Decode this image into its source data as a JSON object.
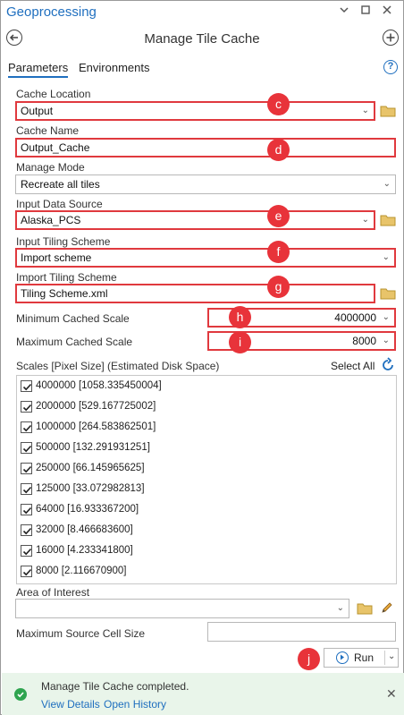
{
  "window": {
    "title": "Geoprocessing",
    "controls": [
      "chevron-down-icon",
      "pin-icon",
      "close-icon"
    ]
  },
  "tool": {
    "title": "Manage Tile Cache"
  },
  "tabs": [
    {
      "label": "Parameters",
      "active": true
    },
    {
      "label": "Environments",
      "active": false
    }
  ],
  "params": {
    "cache_location": {
      "label": "Cache Location",
      "value": "Output",
      "callout": "c"
    },
    "cache_name": {
      "label": "Cache Name",
      "value": "Output_Cache",
      "callout": "d"
    },
    "manage_mode": {
      "label": "Manage Mode",
      "value": "Recreate all tiles"
    },
    "input_data_source": {
      "label": "Input Data Source",
      "value": "Alaska_PCS",
      "callout": "e"
    },
    "input_tiling_scheme": {
      "label": "Input Tiling Scheme",
      "value": "Import scheme",
      "callout": "f"
    },
    "import_tiling_scheme": {
      "label": "Import Tiling Scheme",
      "value": "Tiling Scheme.xml",
      "callout": "g"
    },
    "min_cached_scale": {
      "label": "Minimum Cached Scale",
      "value": "4000000",
      "callout": "h"
    },
    "max_cached_scale": {
      "label": "Maximum Cached Scale",
      "value": "8000",
      "callout": "i"
    }
  },
  "scales": {
    "header": "Scales [Pixel Size] (Estimated Disk Space)",
    "select_all": "Select All",
    "items": [
      {
        "label": "4000000 [1058.335450004]",
        "checked": true
      },
      {
        "label": "2000000 [529.167725002]",
        "checked": true
      },
      {
        "label": "1000000 [264.583862501]",
        "checked": true
      },
      {
        "label": "500000 [132.291931251]",
        "checked": true
      },
      {
        "label": "250000 [66.145965625]",
        "checked": true
      },
      {
        "label": "125000 [33.072982813]",
        "checked": true
      },
      {
        "label": "64000 [16.933367200]",
        "checked": true
      },
      {
        "label": "32000 [8.466683600]",
        "checked": true
      },
      {
        "label": "16000 [4.233341800]",
        "checked": true
      },
      {
        "label": "8000 [2.116670900]",
        "checked": true
      }
    ]
  },
  "area_of_interest": {
    "label": "Area of Interest",
    "value": ""
  },
  "max_source_cell_size": {
    "label": "Maximum Source Cell Size",
    "value": ""
  },
  "run": {
    "label": "Run",
    "callout": "j"
  },
  "status": {
    "message": "Manage Tile Cache completed.",
    "view_details": "View Details",
    "open_history": "Open History"
  },
  "colors": {
    "accent": "#1f6fbf",
    "highlight": "#e0393e",
    "callout": "#e8333a",
    "success": "#2ea44f",
    "status_bg": "#e9f5ea"
  }
}
